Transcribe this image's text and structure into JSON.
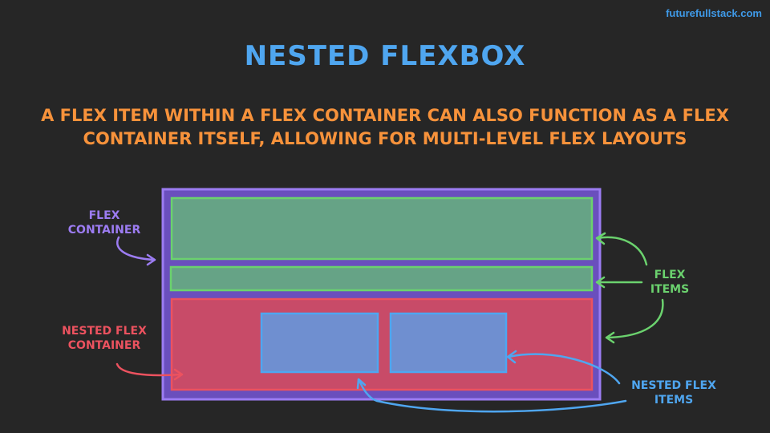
{
  "brand": "futurefullstack.com",
  "title": "NESTED FLEXBOX",
  "subtitle": {
    "line1": "A FLEX ITEM WITHIN A FLEX CONTAINER CAN ALSO FUNCTION AS A FLEX",
    "line2": "CONTAINER ITSELF, ALLOWING FOR MULTI-LEVEL FLEX LAYOUTS"
  },
  "labels": {
    "flex_container": [
      "FLEX",
      "CONTAINER"
    ],
    "flex_items": [
      "FLEX",
      "ITEMS"
    ],
    "nested_flex_container": [
      "NESTED FLEX",
      "CONTAINER"
    ],
    "nested_flex_items": [
      "NESTED FLEX",
      "ITEMS"
    ]
  },
  "colors": {
    "background": "#262626",
    "title": "#4fa6f0",
    "subtitle": "#f7923b",
    "flex_container": "#9c7cf2",
    "flex_item": "#6bd26e",
    "nested_container": "#ec525f",
    "nested_item": "#4fa6f0"
  }
}
